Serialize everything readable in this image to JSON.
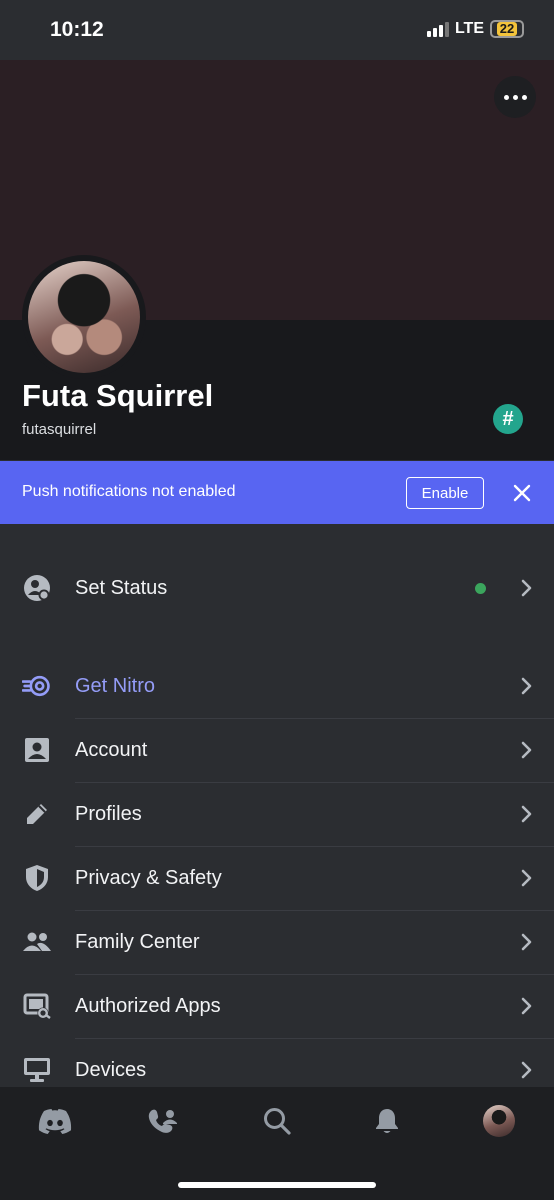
{
  "status_bar": {
    "time": "10:12",
    "network": "LTE",
    "battery": "22"
  },
  "profile": {
    "display_name": "Futa Squirrel",
    "username": "futasquirrel",
    "badge": "#"
  },
  "push_notice": {
    "text": "Push notifications not enabled",
    "enable_label": "Enable"
  },
  "status_section": {
    "label": "Set Status",
    "status_color": "#3ba55d"
  },
  "settings": [
    {
      "label": "Get Nitro",
      "icon": "nitro-icon"
    },
    {
      "label": "Account",
      "icon": "account-icon"
    },
    {
      "label": "Profiles",
      "icon": "pencil-icon"
    },
    {
      "label": "Privacy & Safety",
      "icon": "shield-icon"
    },
    {
      "label": "Family Center",
      "icon": "family-icon"
    },
    {
      "label": "Authorized Apps",
      "icon": "authorized-apps-icon"
    },
    {
      "label": "Devices",
      "icon": "monitor-icon"
    }
  ],
  "tabs": [
    {
      "name": "home",
      "icon": "discord-icon"
    },
    {
      "name": "friends",
      "icon": "friends-icon"
    },
    {
      "name": "search",
      "icon": "search-icon"
    },
    {
      "name": "notifications",
      "icon": "bell-icon"
    },
    {
      "name": "you",
      "icon": "avatar"
    }
  ],
  "colors": {
    "accent": "#5865f2",
    "nitro": "#949cf7",
    "background": "#2b2d31",
    "header": "#18191c",
    "banner": "#2b1f24"
  }
}
